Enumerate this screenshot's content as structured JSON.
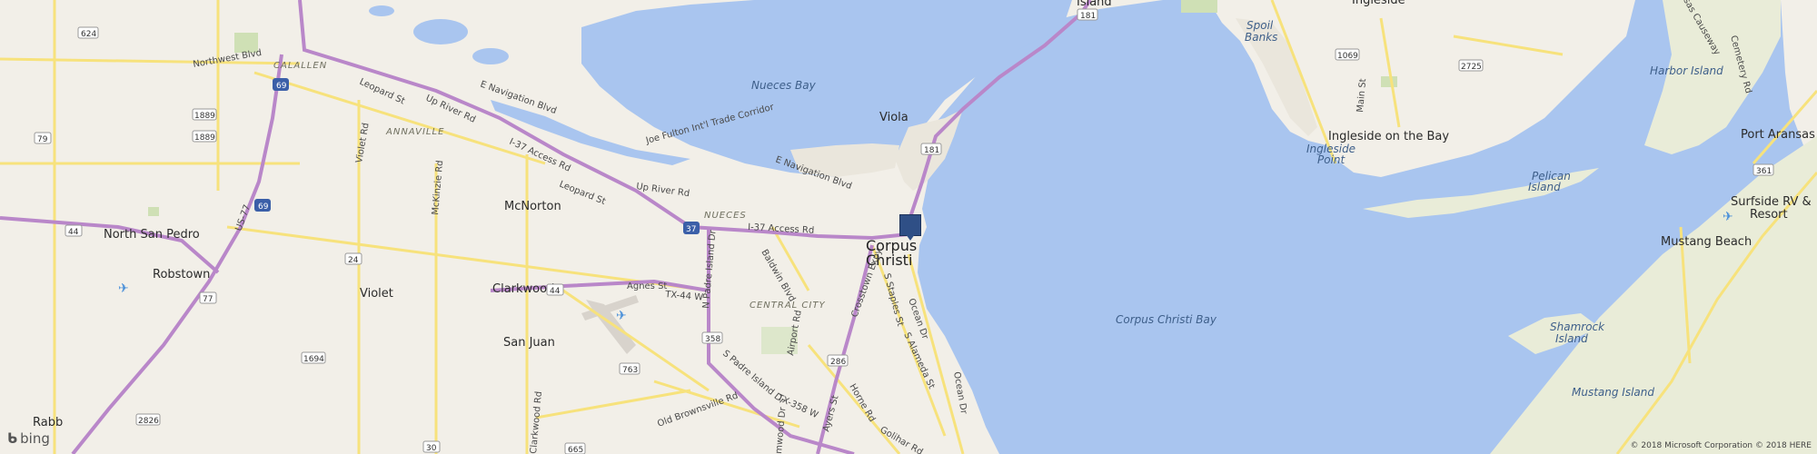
{
  "colors": {
    "water": "#a9c5ef",
    "land": "#f2efe8",
    "interstate": "#b987c9",
    "road": "#f7e27c",
    "marsh": "#e9ecd8"
  },
  "labels": {
    "ingleside_top": "Ingleside",
    "island_top": "Island",
    "nueces_bay": "Nueces Bay",
    "spoil_banks": "Spoil\nBanks",
    "viola": "Viola",
    "mcnorton": "McNorton",
    "north_san_pedro": "North San Pedro",
    "robstown": "Robstown",
    "violet": "Violet",
    "clarkwood": "Clarkwood",
    "san_juan": "San Juan",
    "rabb": "Rabb",
    "corpus_1": "Corpus",
    "corpus_2": "Christi",
    "corpus_christi_bay": "Corpus Christi Bay",
    "ingleside_on_the_bay": "Ingleside on the Bay",
    "ingleside_point_1": "Ingleside",
    "ingleside_point_2": "Point",
    "port_aransas": "Port Aransas",
    "harbor_island": "Harbor Island",
    "pelican_island_1": "Pelican",
    "pelican_island_2": "Island",
    "surfside_1": "Surfside RV &",
    "surfside_2": "Resort",
    "mustang_beach": "Mustang Beach",
    "shamrock_1": "Shamrock",
    "shamrock_2": "Island",
    "mustang_island": "Mustang Island",
    "calallen": "CALALLEN",
    "annaville": "ANNAVILLE",
    "nueces_dist": "NUECES",
    "central_city": "CENTRAL CITY"
  },
  "roads": {
    "northwest_blvd": "Northwest Blvd",
    "leopard_st_1": "Leopard St",
    "up_river_rd_1": "Up River Rd",
    "e_navigation_blvd_1": "E Navigation Blvd",
    "i37_access_1": "I-37 Access Rd",
    "leopard_st_2": "Leopard St",
    "joe_fulton": "Joe Fulton Int'l Trade Corridor",
    "e_navigation_blvd_2": "E Navigation Blvd",
    "up_river_rd_2": "Up River Rd",
    "i37_access_2": "I-37 Access Rd",
    "agnes_st": "Agnes St",
    "tx44w": "TX-44 W",
    "violet_rd": "Violet Rd",
    "mckinzie_rd": "McKinzie Rd",
    "us77": "US-77",
    "n_padre": "N Padre Island Dr",
    "s_padre": "S Padre Island Dr",
    "tx358w": "TX-358 W",
    "baldwin": "Baldwin Blvd",
    "crosstown": "Crosstown Expy",
    "s_staples": "S Staples St",
    "ocean_dr_1": "Ocean Dr",
    "ocean_dr_2": "Ocean Dr",
    "s_alameda": "S Alameda St",
    "airport_rd": "Airport Rd",
    "old_brownsville": "Old Brownsville Rd",
    "clarkwood_rd": "Clarkwood Rd",
    "horne_rd": "Horne Rd",
    "ayers_st": "Ayers St",
    "golihar_rd": "Golihar Rd",
    "weber": "mwood Dr",
    "main_st": "Main St",
    "causeway": "sas Causeway",
    "cemetery_rd": "Cemetery Rd"
  },
  "shields": {
    "s624": "624",
    "s1889a": "1889",
    "s1889b": "1889",
    "s79": "79",
    "s69a": "69",
    "s69b": "69",
    "s44a": "44",
    "s24": "24",
    "s77": "77",
    "s44b": "44",
    "s1694": "1694",
    "s2826": "2826",
    "s30": "30",
    "s665": "665",
    "s358": "358",
    "s763": "763",
    "s286": "286",
    "s181a": "181",
    "s181b": "181",
    "s37": "37",
    "s1069": "1069",
    "s2725": "2725",
    "s361": "361"
  },
  "attribution": {
    "logo": "bing",
    "copyright": "© 2018 Microsoft Corporation © 2018 HERE"
  }
}
